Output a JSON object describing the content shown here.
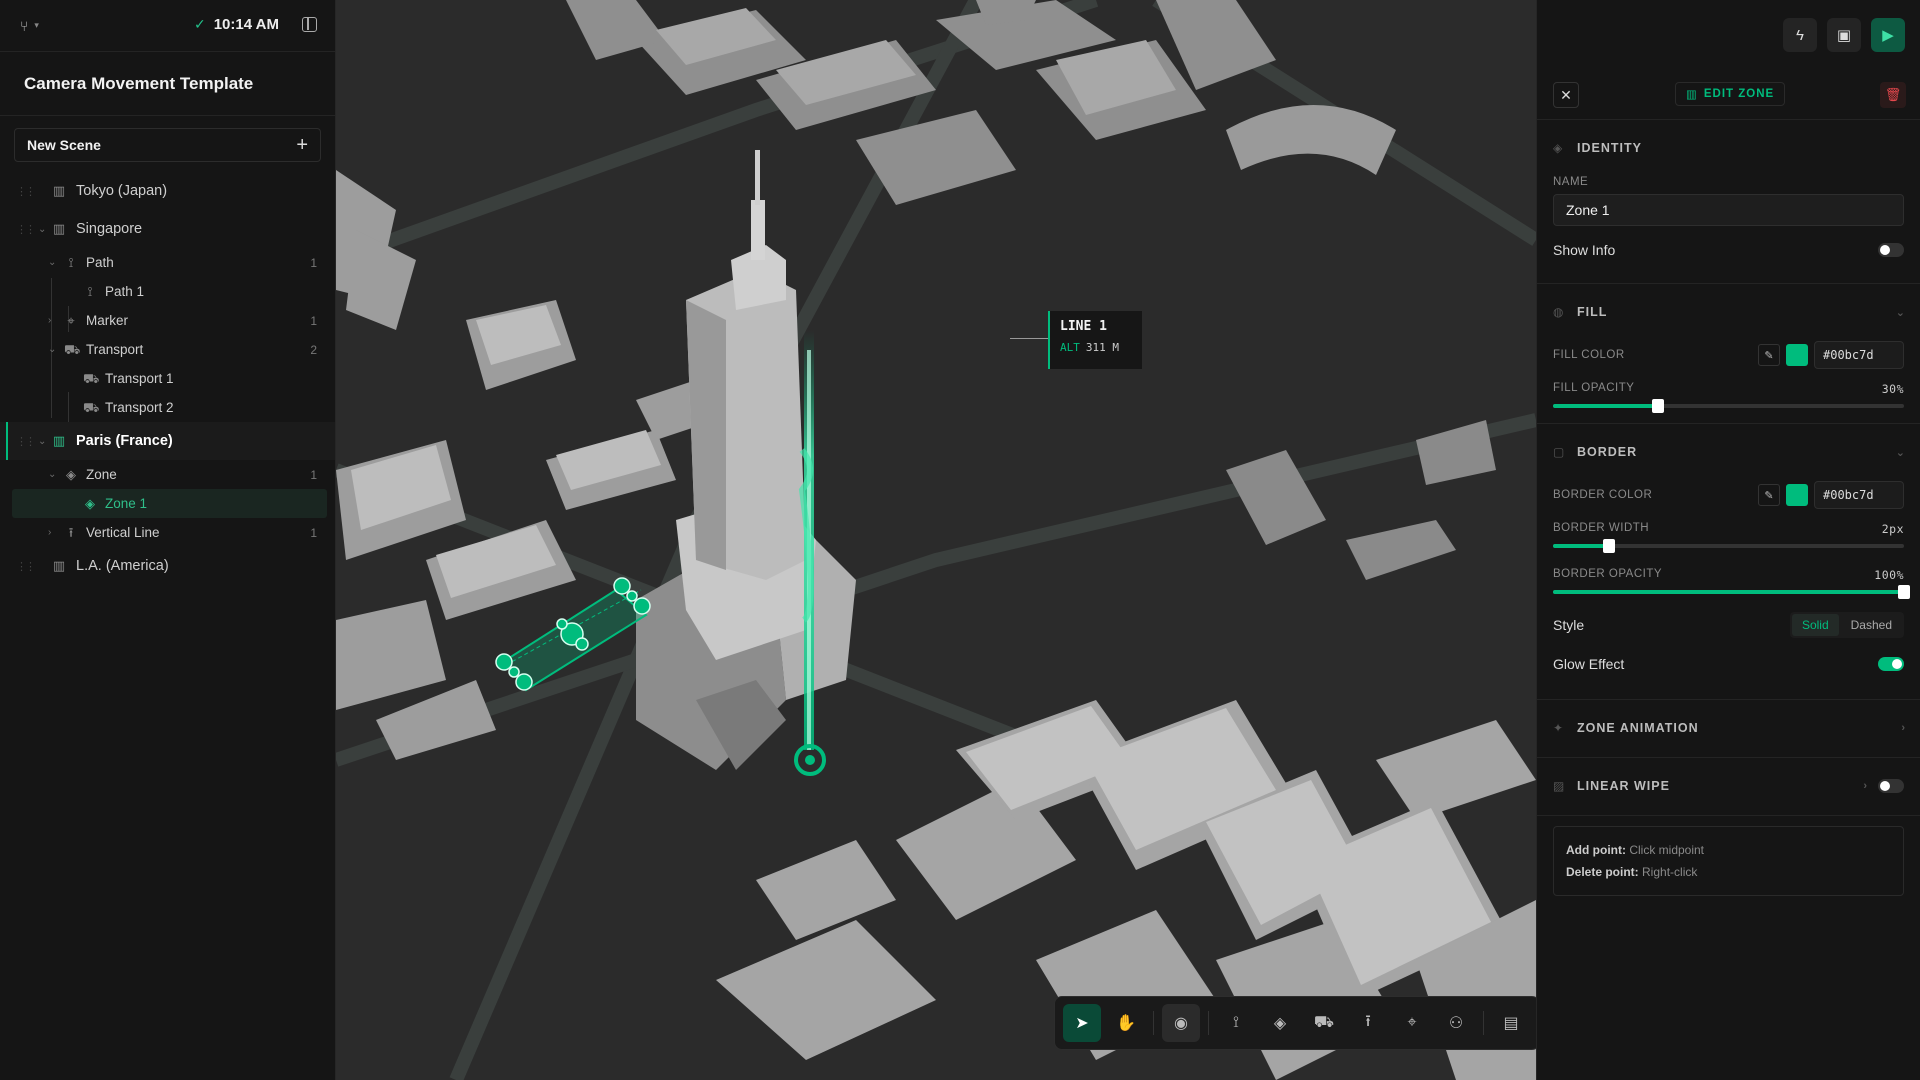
{
  "topbar": {
    "time": "10:14 AM"
  },
  "project": {
    "title": "Camera Movement Template"
  },
  "sidebar": {
    "new_scene": "New Scene",
    "tree": [
      {
        "label": "Tokyo (Japan)"
      },
      {
        "label": "Singapore"
      },
      {
        "label": "Path",
        "count": "1"
      },
      {
        "label": "Path 1"
      },
      {
        "label": "Marker",
        "count": "1"
      },
      {
        "label": "Transport",
        "count": "2"
      },
      {
        "label": "Transport 1"
      },
      {
        "label": "Transport 2"
      },
      {
        "label": "Paris (France)"
      },
      {
        "label": "Zone",
        "count": "1"
      },
      {
        "label": "Zone 1"
      },
      {
        "label": "Vertical Line",
        "count": "1"
      },
      {
        "label": "L.A. (America)"
      }
    ]
  },
  "map": {
    "line_label": {
      "title": "LINE 1",
      "alt_key": "ALT",
      "alt_value": "311 M"
    },
    "accent": "#00bc7d"
  },
  "panel": {
    "header": {
      "edit_label": "EDIT ZONE"
    },
    "identity": {
      "title": "IDENTITY",
      "name_label": "NAME",
      "name_value": "Zone 1",
      "show_info": "Show Info"
    },
    "fill": {
      "title": "FILL",
      "color_label": "FILL COLOR",
      "color_hex": "#00bc7d",
      "opacity_label": "FILL OPACITY",
      "opacity_value": "30%"
    },
    "border": {
      "title": "BORDER",
      "color_label": "BORDER COLOR",
      "color_hex": "#00bc7d",
      "width_label": "BORDER WIDTH",
      "width_value": "2px",
      "opacity_label": "BORDER OPACITY",
      "opacity_value": "100%",
      "style_label": "Style",
      "style_solid": "Solid",
      "style_dashed": "Dashed",
      "glow_label": "Glow Effect"
    },
    "zone_animation": {
      "title": "ZONE ANIMATION"
    },
    "linear_wipe": {
      "title": "LINEAR WIPE"
    },
    "help": {
      "add_key": "Add point:",
      "add_val": "Click midpoint",
      "del_key": "Delete point:",
      "del_val": "Right-click"
    }
  }
}
